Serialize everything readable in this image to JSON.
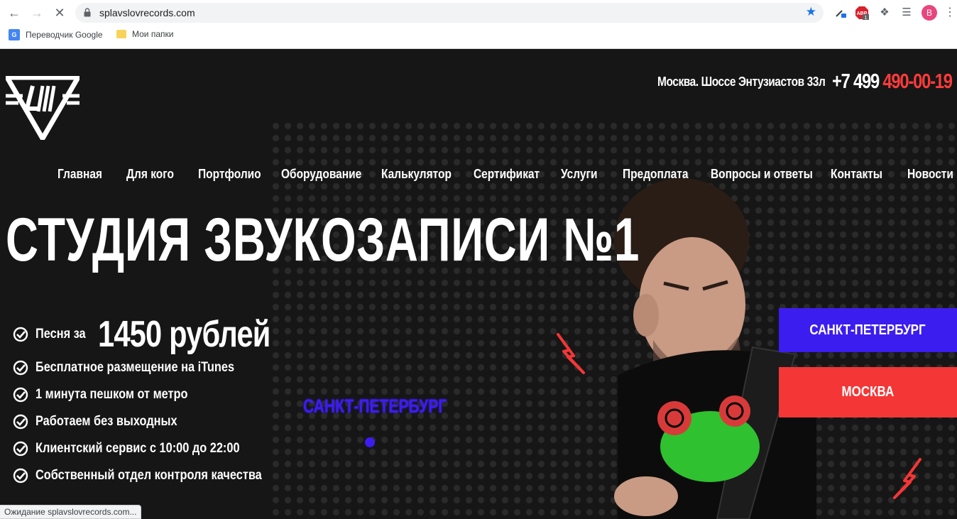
{
  "browser": {
    "url": "splavslovrecords.com",
    "profile_initial": "B",
    "bookmarks": [
      {
        "label": "Переводчик Google"
      },
      {
        "label": "Мои папки"
      }
    ],
    "status_text": "Ожидание splavslovrecords.com...",
    "icons": [
      "back-icon",
      "forward-icon",
      "stop-icon",
      "lock-icon",
      "star-icon",
      "eyedropper-icon",
      "adblock-icon",
      "puzzle-icon",
      "media-queue-icon",
      "menu-icon"
    ]
  },
  "header": {
    "address": "Москва. Шоссе Энтузиастов 33л",
    "phone_code": "+7 499",
    "phone_number": "490-00-19"
  },
  "nav": {
    "items": [
      {
        "label": "Главная"
      },
      {
        "label": "Для кого"
      },
      {
        "label": "Портфолио"
      },
      {
        "label": "Оборудование"
      },
      {
        "label": "Калькулятор"
      },
      {
        "label": "Сертификат"
      },
      {
        "label": "Услуги"
      },
      {
        "label": "Предоплата"
      },
      {
        "label": "Вопросы и ответы"
      },
      {
        "label": "Контакты"
      },
      {
        "label": "Новости"
      }
    ]
  },
  "hero": {
    "title": "СТУДИЯ ЗВУКОЗАПИСИ №1",
    "price_prefix": "Песня за",
    "price": "1450 рублей",
    "features": [
      "Бесплатное размещение на iTunes",
      "1 минута пешком от метро",
      "Работаем без выходных",
      "Клиентский сервис с 10:00 до 22:00",
      "Собственный отдел контроля качества"
    ],
    "map_city": "САНКТ-ПЕТЕРБУРГ"
  },
  "cities": {
    "spb": "САНКТ-ПЕТЕРБУРГ",
    "msk": "МОСКВА"
  },
  "colors": {
    "accent_blue": "#3c1df0",
    "accent_red": "#f43636",
    "background": "#161616"
  }
}
